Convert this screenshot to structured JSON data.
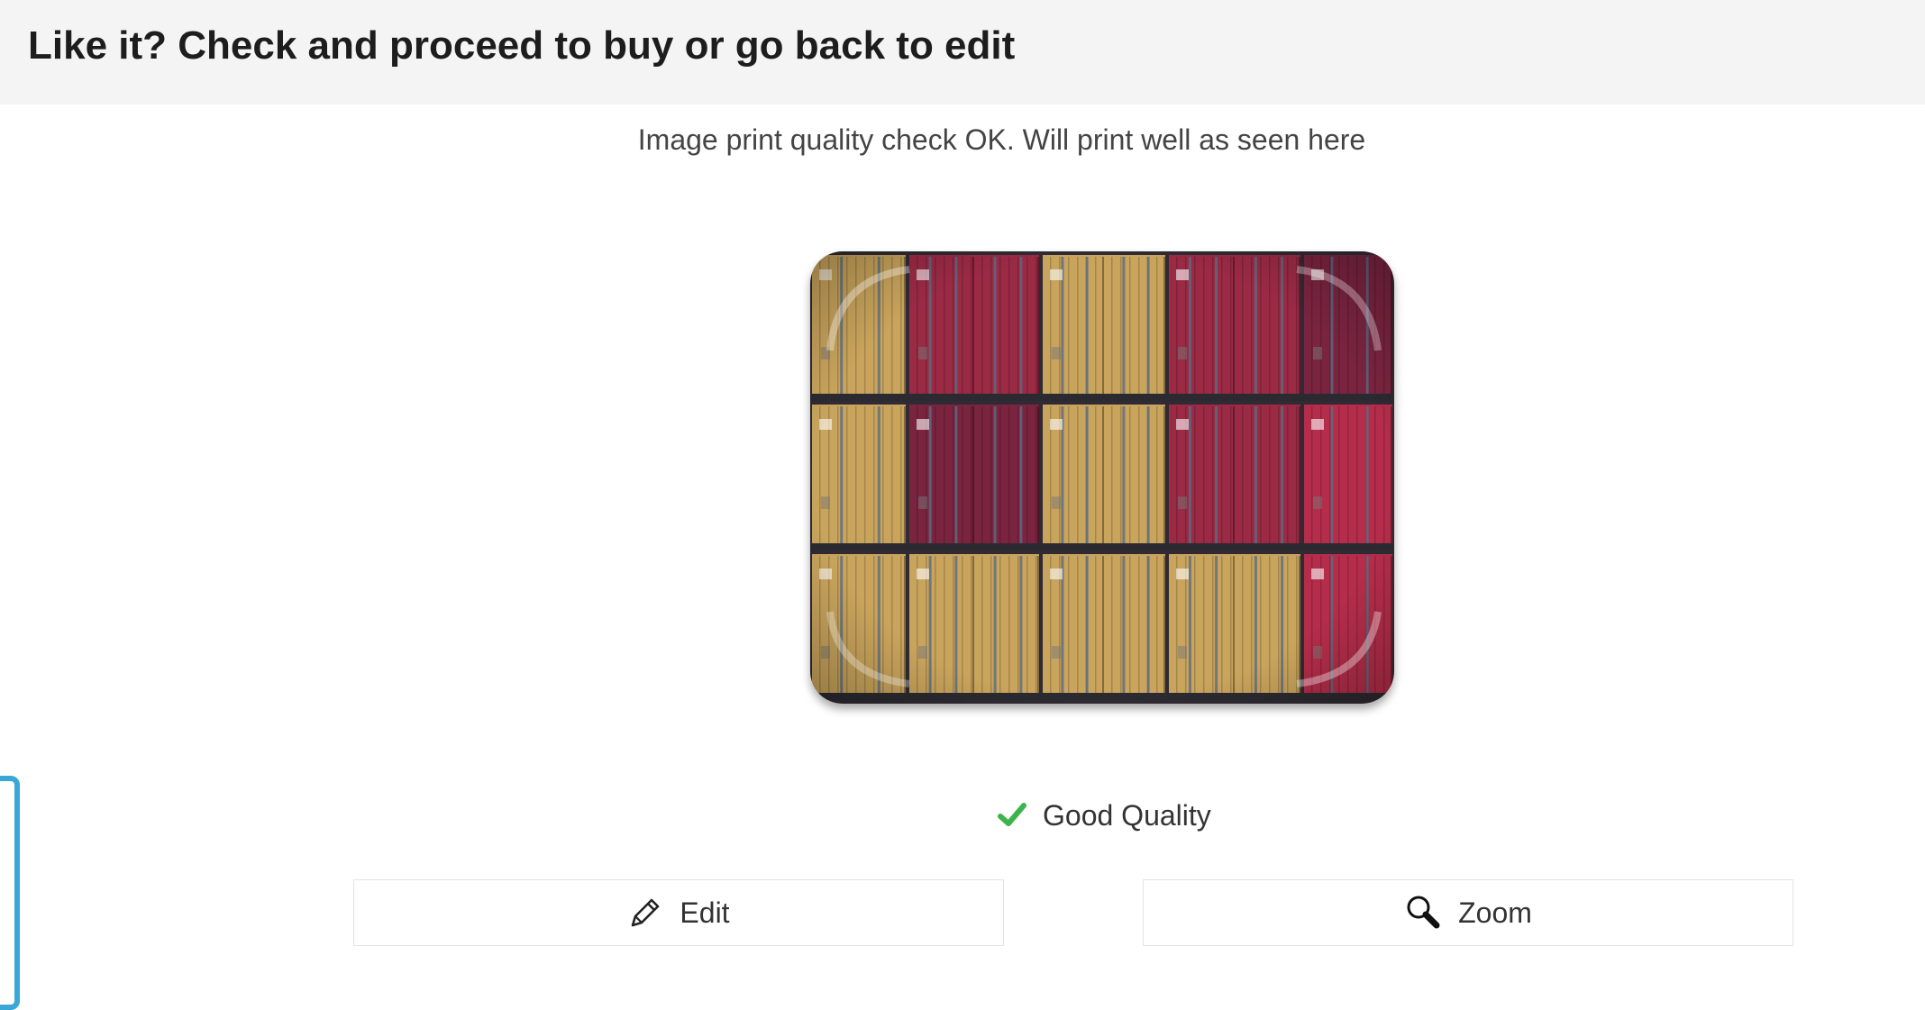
{
  "header": {
    "title": "Like it? Check and proceed to buy or go back to edit"
  },
  "preview": {
    "quality_message": "Image print quality check OK. Will print well as seen here",
    "product": "tray-icon"
  },
  "quality": {
    "label": "Good Quality",
    "icon": "checkmark-icon",
    "color": "#3cb44b"
  },
  "buttons": {
    "edit": {
      "label": "Edit",
      "icon": "pencil-icon"
    },
    "zoom": {
      "label": "Zoom",
      "icon": "magnifier-icon"
    }
  },
  "colors": {
    "header_bg": "#f4f4f4",
    "accent": "#3aa8d4"
  }
}
